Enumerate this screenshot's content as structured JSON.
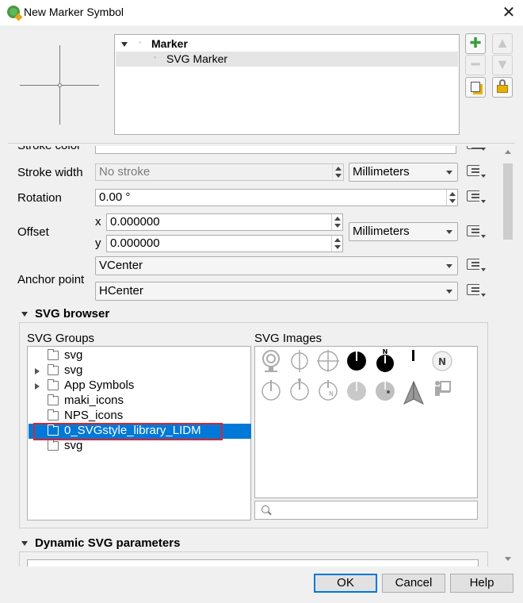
{
  "window": {
    "title": "New Marker Symbol",
    "close_glyph": "✕"
  },
  "layers": [
    {
      "label": "Marker"
    },
    {
      "label": "SVG Marker"
    }
  ],
  "properties": {
    "stroke_color_label": "Stroke color",
    "stroke_width": {
      "label": "Stroke width",
      "value": "No stroke",
      "unit": "Millimeters"
    },
    "rotation": {
      "label": "Rotation",
      "value": "0.00 °"
    },
    "offset": {
      "label": "Offset",
      "x_label": "x",
      "x_value": "0.000000",
      "y_label": "y",
      "y_value": "0.000000",
      "unit": "Millimeters"
    },
    "anchor": {
      "label": "Anchor point",
      "vertical": "VCenter",
      "horizontal": "HCenter"
    }
  },
  "svg_browser": {
    "header": "SVG browser",
    "groups_label": "SVG Groups",
    "images_label": "SVG Images",
    "groups": [
      {
        "label": "svg",
        "expandable": false
      },
      {
        "label": "svg",
        "expandable": true
      },
      {
        "label": "App Symbols",
        "expandable": true
      },
      {
        "label": "maki_icons",
        "expandable": false
      },
      {
        "label": "NPS_icons",
        "expandable": false
      },
      {
        "label": "0_SVGstyle_library_LIDM",
        "expandable": false,
        "selected": true
      },
      {
        "label": "svg",
        "expandable": false
      }
    ],
    "search_placeholder": "",
    "north_letter": "N"
  },
  "dynamic_header": "Dynamic SVG parameters",
  "buttons": {
    "ok": "OK",
    "cancel": "Cancel",
    "help": "Help"
  },
  "colors": {
    "selection": "#0078d7",
    "highlight_box": "#d9242f",
    "add_icon": "#3a9d3a",
    "lock_icon": "#e8b100"
  }
}
